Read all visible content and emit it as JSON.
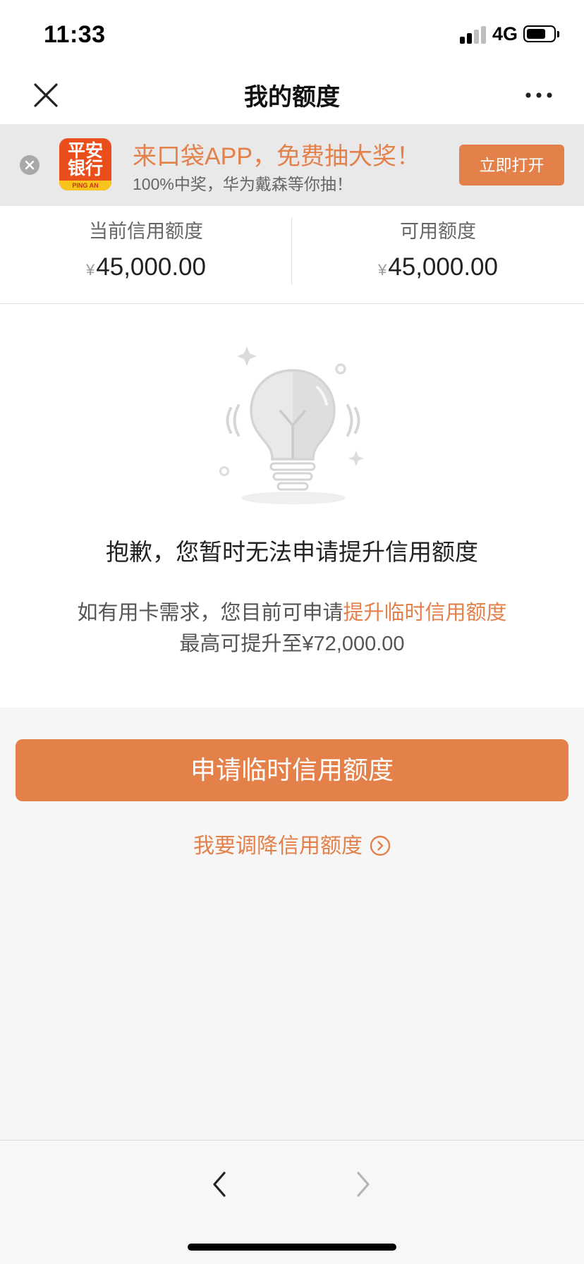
{
  "status_bar": {
    "time": "11:33",
    "network": "4G",
    "signal_bars_active": 2,
    "signal_bars_total": 4
  },
  "nav": {
    "title": "我的额度",
    "close_icon": "close-icon",
    "more_icon": "more-dots-icon"
  },
  "promo": {
    "logo_text": "平安银行",
    "logo_sub": "PING AN",
    "title": "来口袋APP，免费抽大奖！",
    "subtitle": "100%中奖，华为戴森等你抽！",
    "button_label": "立即打开",
    "close_icon": "close-circle-icon"
  },
  "limits": {
    "currency_symbol": "¥",
    "current": {
      "label": "当前信用额度",
      "amount": "45,000.00"
    },
    "available": {
      "label": "可用额度",
      "amount": "45,000.00"
    }
  },
  "message": {
    "illustration": "lightbulb-icon",
    "title": "抱歉，您暂时无法申请提升信用额度",
    "line1_prefix": "如有用卡需求，您目前可申请",
    "line1_highlight": "提升临时信用额度",
    "line2": "最高可提升至¥72,000.00"
  },
  "actions": {
    "primary_label": "申请临时信用额度",
    "secondary_label": "我要调降信用额度"
  },
  "bottom_bar": {
    "back_icon": "chevron-left-icon",
    "forward_icon": "chevron-right-icon"
  },
  "colors": {
    "accent": "#e4804a",
    "banner_bg": "#e9e9e9",
    "page_bg": "#f6f6f6",
    "logo_red": "#e94e1b",
    "logo_yellow": "#f7c31c"
  }
}
